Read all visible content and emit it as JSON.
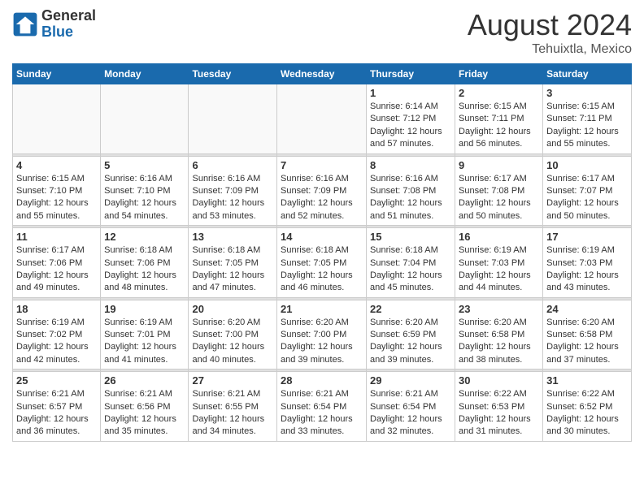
{
  "header": {
    "logo": {
      "general": "General",
      "blue": "Blue"
    },
    "title": "August 2024",
    "location": "Tehuixtla, Mexico"
  },
  "weekdays": [
    "Sunday",
    "Monday",
    "Tuesday",
    "Wednesday",
    "Thursday",
    "Friday",
    "Saturday"
  ],
  "weeks": [
    [
      {
        "day": "",
        "info": ""
      },
      {
        "day": "",
        "info": ""
      },
      {
        "day": "",
        "info": ""
      },
      {
        "day": "",
        "info": ""
      },
      {
        "day": "1",
        "info": "Sunrise: 6:14 AM\nSunset: 7:12 PM\nDaylight: 12 hours\nand 57 minutes."
      },
      {
        "day": "2",
        "info": "Sunrise: 6:15 AM\nSunset: 7:11 PM\nDaylight: 12 hours\nand 56 minutes."
      },
      {
        "day": "3",
        "info": "Sunrise: 6:15 AM\nSunset: 7:11 PM\nDaylight: 12 hours\nand 55 minutes."
      }
    ],
    [
      {
        "day": "4",
        "info": "Sunrise: 6:15 AM\nSunset: 7:10 PM\nDaylight: 12 hours\nand 55 minutes."
      },
      {
        "day": "5",
        "info": "Sunrise: 6:16 AM\nSunset: 7:10 PM\nDaylight: 12 hours\nand 54 minutes."
      },
      {
        "day": "6",
        "info": "Sunrise: 6:16 AM\nSunset: 7:09 PM\nDaylight: 12 hours\nand 53 minutes."
      },
      {
        "day": "7",
        "info": "Sunrise: 6:16 AM\nSunset: 7:09 PM\nDaylight: 12 hours\nand 52 minutes."
      },
      {
        "day": "8",
        "info": "Sunrise: 6:16 AM\nSunset: 7:08 PM\nDaylight: 12 hours\nand 51 minutes."
      },
      {
        "day": "9",
        "info": "Sunrise: 6:17 AM\nSunset: 7:08 PM\nDaylight: 12 hours\nand 50 minutes."
      },
      {
        "day": "10",
        "info": "Sunrise: 6:17 AM\nSunset: 7:07 PM\nDaylight: 12 hours\nand 50 minutes."
      }
    ],
    [
      {
        "day": "11",
        "info": "Sunrise: 6:17 AM\nSunset: 7:06 PM\nDaylight: 12 hours\nand 49 minutes."
      },
      {
        "day": "12",
        "info": "Sunrise: 6:18 AM\nSunset: 7:06 PM\nDaylight: 12 hours\nand 48 minutes."
      },
      {
        "day": "13",
        "info": "Sunrise: 6:18 AM\nSunset: 7:05 PM\nDaylight: 12 hours\nand 47 minutes."
      },
      {
        "day": "14",
        "info": "Sunrise: 6:18 AM\nSunset: 7:05 PM\nDaylight: 12 hours\nand 46 minutes."
      },
      {
        "day": "15",
        "info": "Sunrise: 6:18 AM\nSunset: 7:04 PM\nDaylight: 12 hours\nand 45 minutes."
      },
      {
        "day": "16",
        "info": "Sunrise: 6:19 AM\nSunset: 7:03 PM\nDaylight: 12 hours\nand 44 minutes."
      },
      {
        "day": "17",
        "info": "Sunrise: 6:19 AM\nSunset: 7:03 PM\nDaylight: 12 hours\nand 43 minutes."
      }
    ],
    [
      {
        "day": "18",
        "info": "Sunrise: 6:19 AM\nSunset: 7:02 PM\nDaylight: 12 hours\nand 42 minutes."
      },
      {
        "day": "19",
        "info": "Sunrise: 6:19 AM\nSunset: 7:01 PM\nDaylight: 12 hours\nand 41 minutes."
      },
      {
        "day": "20",
        "info": "Sunrise: 6:20 AM\nSunset: 7:00 PM\nDaylight: 12 hours\nand 40 minutes."
      },
      {
        "day": "21",
        "info": "Sunrise: 6:20 AM\nSunset: 7:00 PM\nDaylight: 12 hours\nand 39 minutes."
      },
      {
        "day": "22",
        "info": "Sunrise: 6:20 AM\nSunset: 6:59 PM\nDaylight: 12 hours\nand 39 minutes."
      },
      {
        "day": "23",
        "info": "Sunrise: 6:20 AM\nSunset: 6:58 PM\nDaylight: 12 hours\nand 38 minutes."
      },
      {
        "day": "24",
        "info": "Sunrise: 6:20 AM\nSunset: 6:58 PM\nDaylight: 12 hours\nand 37 minutes."
      }
    ],
    [
      {
        "day": "25",
        "info": "Sunrise: 6:21 AM\nSunset: 6:57 PM\nDaylight: 12 hours\nand 36 minutes."
      },
      {
        "day": "26",
        "info": "Sunrise: 6:21 AM\nSunset: 6:56 PM\nDaylight: 12 hours\nand 35 minutes."
      },
      {
        "day": "27",
        "info": "Sunrise: 6:21 AM\nSunset: 6:55 PM\nDaylight: 12 hours\nand 34 minutes."
      },
      {
        "day": "28",
        "info": "Sunrise: 6:21 AM\nSunset: 6:54 PM\nDaylight: 12 hours\nand 33 minutes."
      },
      {
        "day": "29",
        "info": "Sunrise: 6:21 AM\nSunset: 6:54 PM\nDaylight: 12 hours\nand 32 minutes."
      },
      {
        "day": "30",
        "info": "Sunrise: 6:22 AM\nSunset: 6:53 PM\nDaylight: 12 hours\nand 31 minutes."
      },
      {
        "day": "31",
        "info": "Sunrise: 6:22 AM\nSunset: 6:52 PM\nDaylight: 12 hours\nand 30 minutes."
      }
    ]
  ]
}
